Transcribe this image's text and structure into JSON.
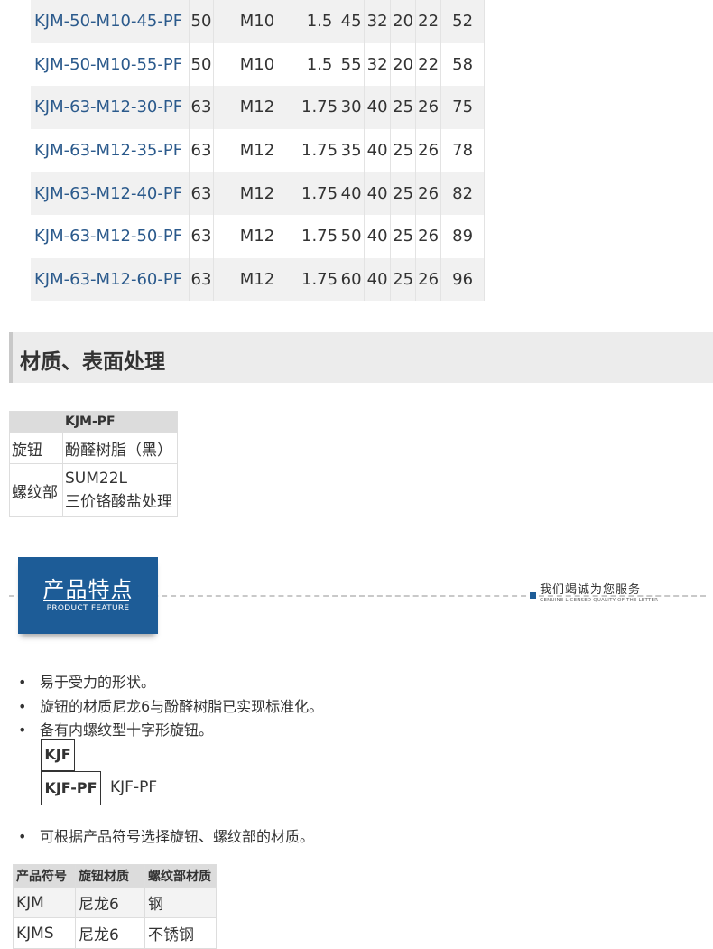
{
  "spec_table": {
    "rows": [
      [
        "KJM-50-M10-45-PF",
        "50",
        "M10",
        "1.5",
        "45",
        "32",
        "20",
        "22",
        "52"
      ],
      [
        "KJM-50-M10-55-PF",
        "50",
        "M10",
        "1.5",
        "55",
        "32",
        "20",
        "22",
        "58"
      ],
      [
        "KJM-63-M12-30-PF",
        "63",
        "M12",
        "1.75",
        "30",
        "40",
        "25",
        "26",
        "75"
      ],
      [
        "KJM-63-M12-35-PF",
        "63",
        "M12",
        "1.75",
        "35",
        "40",
        "25",
        "26",
        "78"
      ],
      [
        "KJM-63-M12-40-PF",
        "63",
        "M12",
        "1.75",
        "40",
        "40",
        "25",
        "26",
        "82"
      ],
      [
        "KJM-63-M12-50-PF",
        "63",
        "M12",
        "1.75",
        "50",
        "40",
        "25",
        "26",
        "89"
      ],
      [
        "KJM-63-M12-60-PF",
        "63",
        "M12",
        "1.75",
        "60",
        "40",
        "25",
        "26",
        "96"
      ]
    ]
  },
  "material_section": {
    "title": "材质、表面处理",
    "header": "KJM-PF",
    "knob_label": "旋钮",
    "knob_value": "酚醛树脂（黑）",
    "thread_label": "螺纹部",
    "thread_value_1": "SUM22L",
    "thread_value_2": "三价铬酸盐处理"
  },
  "feature_banner": {
    "title": "产品特点",
    "subtitle": "PRODUCT FEATURE",
    "slogan": "我们竭诚为您服务",
    "slogan_en": "GENUINE LICENSED QUALITY OF THE LETTER",
    "accent_color": "#1d5c97"
  },
  "features": {
    "b1": "易于受力的形状。",
    "b2": "旋钮的材质尼龙6与酚醛树脂已实现标准化。",
    "b3": "备有内螺纹型十字形旋钮。",
    "b4": "可根据产品符号选择旋钮、螺纹部的材质。",
    "tag_kjf": "KJF",
    "tag_kjfpf": "KJF-PF",
    "tag_kjfpf_text": "KJF-PF"
  },
  "symbol_table": {
    "headers": [
      "产品符号",
      "旋钮材质",
      "螺纹部材质"
    ],
    "rows": [
      [
        "KJM",
        "尼龙6",
        "钢"
      ],
      [
        "KJMS",
        "尼龙6",
        "不锈钢"
      ]
    ]
  }
}
